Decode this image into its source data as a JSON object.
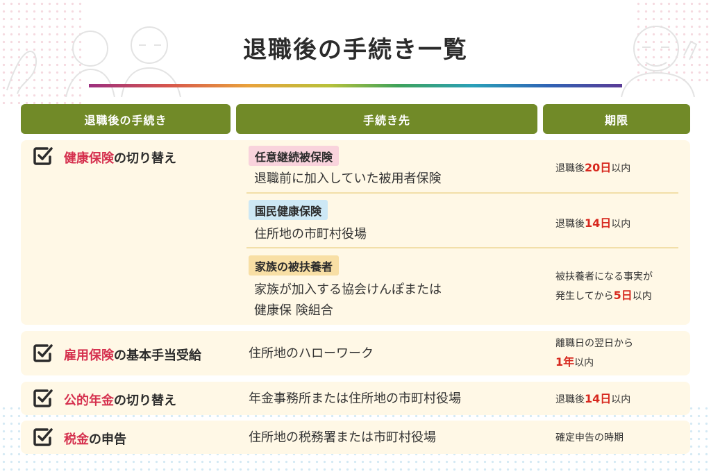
{
  "title": "退職後の手続き一覧",
  "headers": {
    "col1": "退職後の手続き",
    "col2": "手続き先",
    "col3": "期限"
  },
  "colors": {
    "header_bg": "#718a28",
    "card_bg": "#fff8e6",
    "highlight_text": "#d5304e",
    "deadline_number": "#d7281e"
  },
  "icons": [
    "checkbox-icon",
    "elderly-people-illustration"
  ],
  "rows": {
    "health": {
      "label_hl": "健康保険",
      "label_rest": "の切り替え",
      "options": [
        {
          "tag": "任意継続被保険",
          "dest": "退職前に加入していた被用者保険",
          "deadline_pre": "退職後",
          "deadline_num": "20日",
          "deadline_post": "以内"
        },
        {
          "tag": "国民健康保険",
          "dest": "住所地の市町村役場",
          "deadline_pre": "退職後",
          "deadline_num": "14日",
          "deadline_post": "以内"
        },
        {
          "tag": "家族の被扶養者",
          "dest_line1": "家族が加入する協会けんぽまたは",
          "dest_line2": "健康保 険組合",
          "deadline_line1": "被扶養者になる事実が",
          "deadline_pre": "発生してから",
          "deadline_num": "5日",
          "deadline_post": "以内"
        }
      ]
    },
    "employment": {
      "label_hl": "雇用保険",
      "label_rest": "の基本手当受給",
      "dest": "住所地のハローワーク",
      "deadline_line1": "離職日の翌日から",
      "deadline_num": "1年",
      "deadline_post": "以内"
    },
    "pension": {
      "label_hl": "公的年金",
      "label_rest": "の切り替え",
      "dest": "年金事務所または住所地の市町村役場",
      "deadline_pre": "退職後",
      "deadline_num": "14日",
      "deadline_post": "以内"
    },
    "tax": {
      "label_hl": "税金",
      "label_rest": "の申告",
      "dest": "住所地の税務署または市町村役場",
      "deadline": "確定申告の時期"
    }
  }
}
